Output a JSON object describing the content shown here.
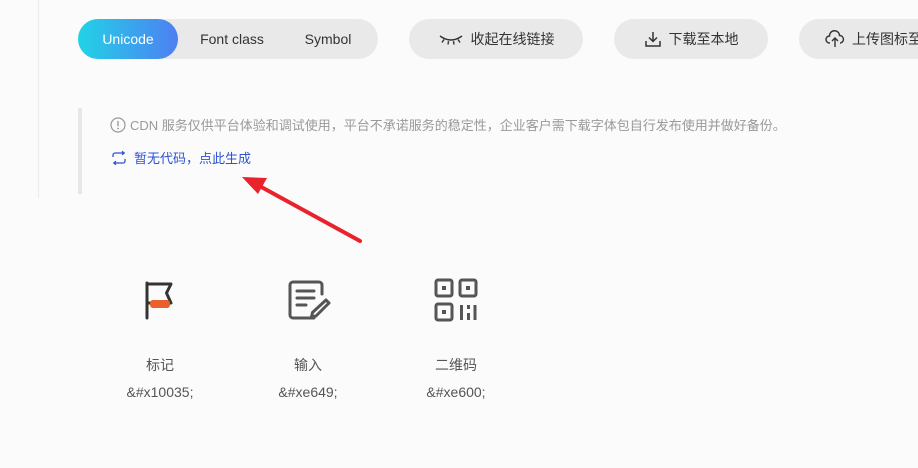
{
  "toolbar": {
    "tabs": [
      {
        "label": "Unicode",
        "active": true
      },
      {
        "label": "Font class",
        "active": false
      },
      {
        "label": "Symbol",
        "active": false
      }
    ],
    "collapse_link_label": "收起在线链接",
    "download_label": "下载至本地",
    "upload_label": "上传图标至"
  },
  "notice": {
    "text": "CDN 服务仅供平台体验和调试使用，平台不承诺服务的稳定性，企业客户需下载字体包自行发布使用并做好备份。",
    "generate_link": "暂无代码，点此生成"
  },
  "icons": [
    {
      "name": "标记",
      "code": "&#x10035;",
      "icon": "flag-icon"
    },
    {
      "name": "输入",
      "code": "&#xe649;",
      "icon": "edit-document-icon"
    },
    {
      "name": "二维码",
      "code": "&#xe600;",
      "icon": "qrcode-icon"
    }
  ],
  "colors": {
    "tab_gradient_start": "#22d3e6",
    "tab_gradient_end": "#4e7ff2",
    "link": "#2b53d4",
    "accent_orange": "#e8602a",
    "annotation_arrow": "#e8232b"
  }
}
